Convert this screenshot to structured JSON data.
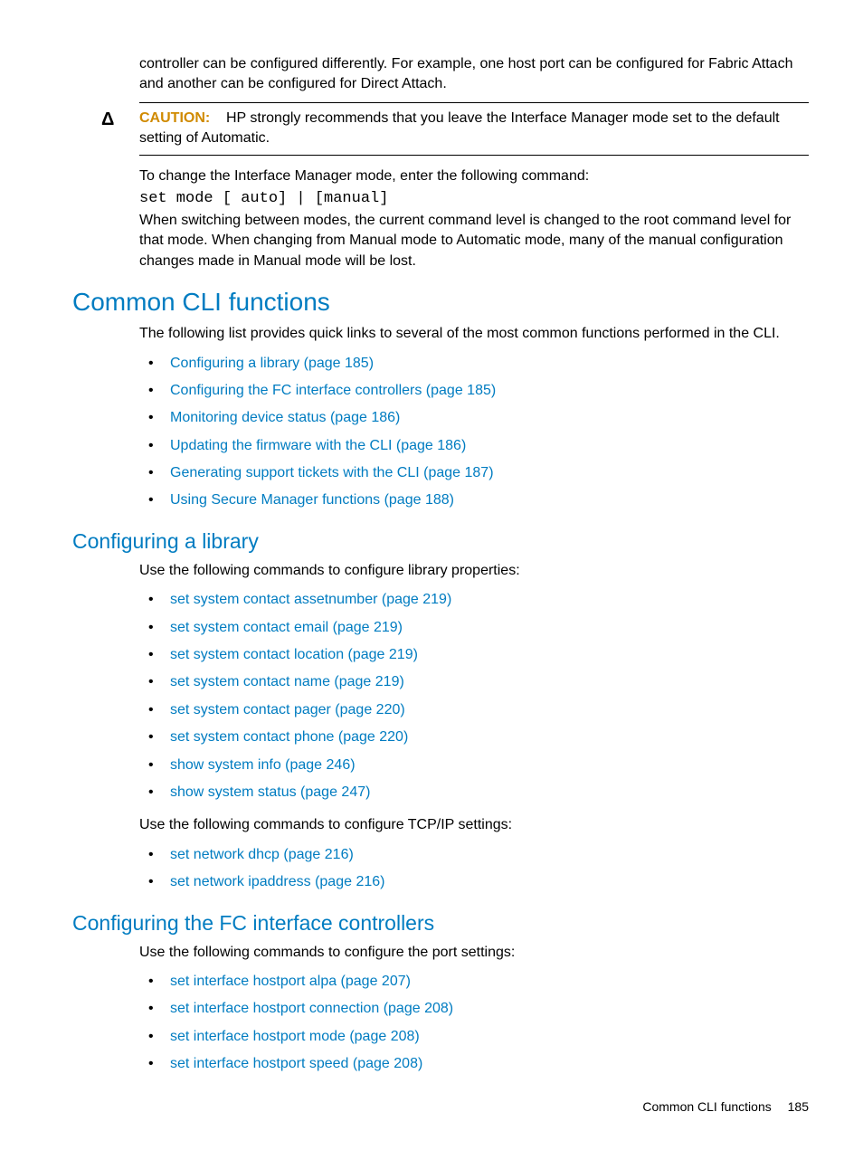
{
  "intro_para": "controller can be configured differently. For example, one host port can be configured for Fabric Attach and another can be configured for Direct Attach.",
  "caution_icon": "Δ",
  "caution_label": "CAUTION:",
  "caution_text": "HP strongly recommends that you leave the Interface Manager mode set to the default setting of Automatic.",
  "change_mode_text": "To change the Interface Manager mode, enter the following command:",
  "code_line": "set mode [ auto] | [manual]",
  "switching_text": "When switching between modes, the current command level is changed to the root command level for that mode. When changing from Manual mode to Automatic mode, many of the manual configuration changes made in Manual mode will be lost.",
  "h1_common": "Common CLI functions",
  "common_intro": "The following list provides quick links to several of the most common functions performed in the CLI.",
  "common_links": [
    "Configuring a library (page 185)",
    "Configuring the FC interface controllers (page 185)",
    "Monitoring device status (page 186)",
    "Updating the firmware with the CLI (page 186)",
    "Generating support tickets with the CLI (page 187)",
    "Using Secure Manager functions (page 188)"
  ],
  "h2_config_lib": "Configuring a library",
  "config_lib_intro": "Use the following commands to configure library properties:",
  "config_lib_links": [
    "set system contact assetnumber (page 219)",
    "set system contact email (page 219)",
    "set system contact location (page 219)",
    "set system contact name (page 219)",
    "set system contact pager (page 220)",
    "set system contact phone (page 220)",
    "show system info (page 246)",
    "show system status (page 247)"
  ],
  "config_lib_tcpip_intro": "Use the following commands to configure TCP/IP settings:",
  "config_lib_tcpip_links": [
    "set network dhcp (page 216)",
    "set network ipaddress (page 216)"
  ],
  "h2_config_fc": "Configuring the FC interface controllers",
  "config_fc_intro": "Use the following commands to configure the port settings:",
  "config_fc_links": [
    "set interface hostport alpa (page 207)",
    "set interface hostport connection (page 208)",
    "set interface hostport mode (page 208)",
    "set interface hostport speed (page 208)"
  ],
  "footer_title": "Common CLI functions",
  "footer_page": "185"
}
